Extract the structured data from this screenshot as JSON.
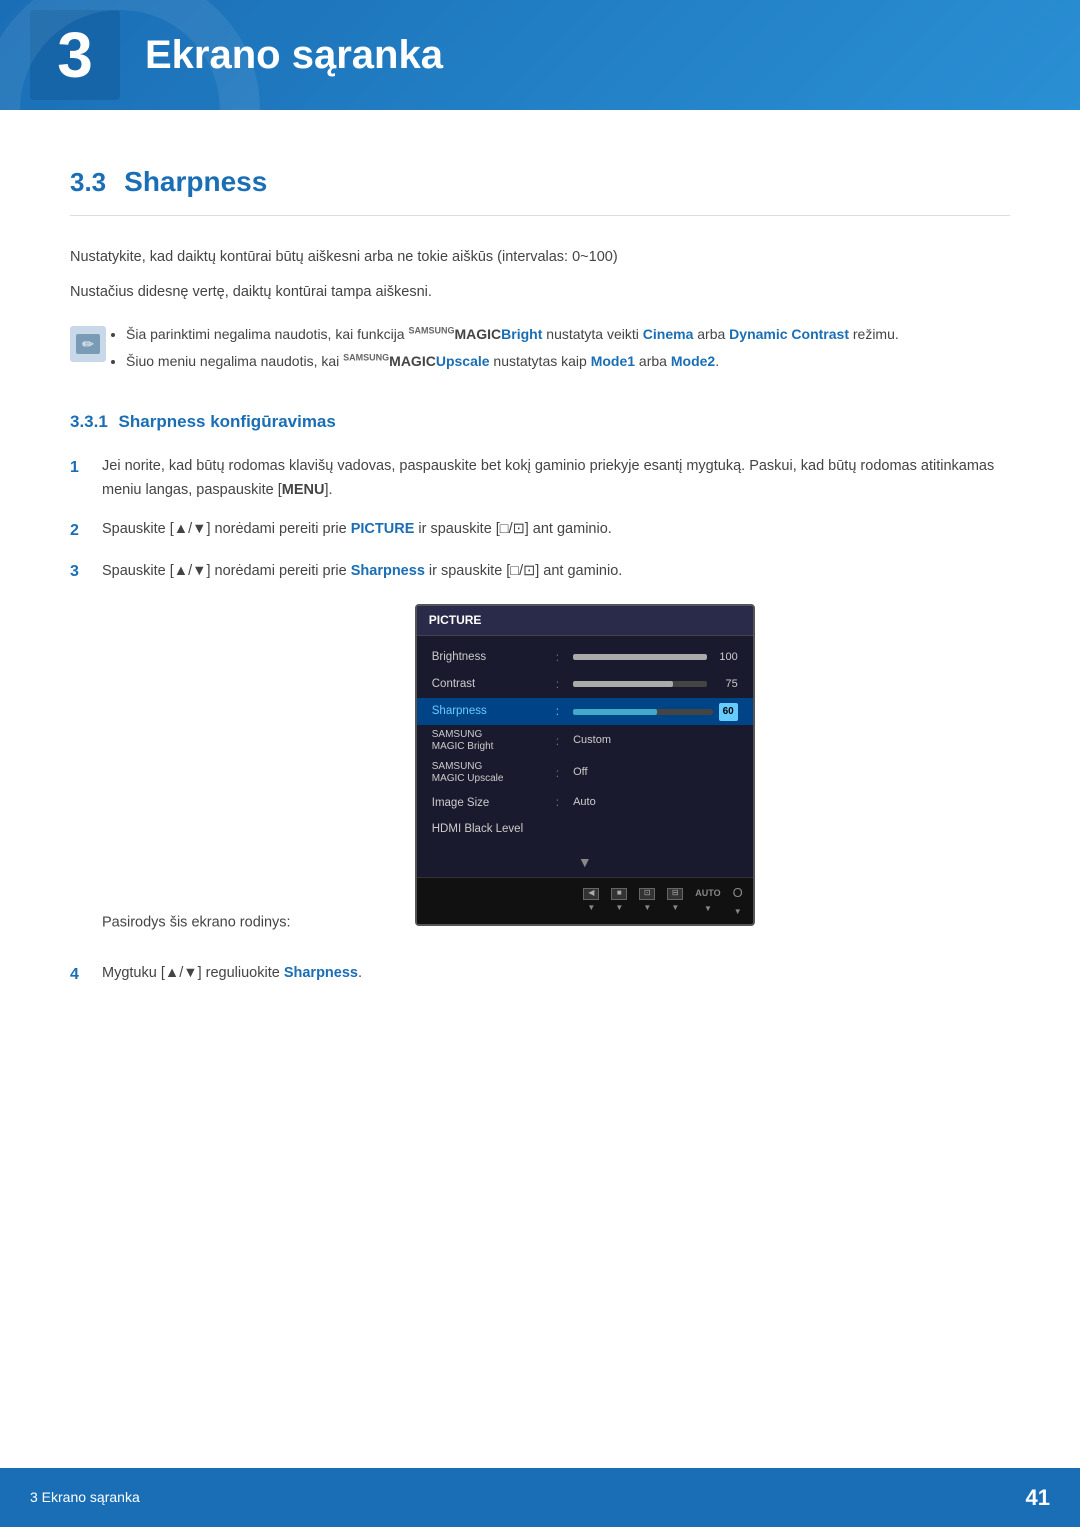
{
  "header": {
    "chapter_number": "3",
    "chapter_title": "Ekrano sąranka"
  },
  "section": {
    "number": "3.3",
    "title": "Sharpness",
    "description1": "Nustatykite, kad daiktų kontūrai būtų aiškesni arba ne tokie aiškūs (intervalas: 0~100)",
    "description2": "Nustačius didesnę vertę, daiktų kontūrai tampa aiškesni.",
    "notes": [
      "Šia parinktimi negalima naudotis, kai funkcija SAMSUNGBright nustatyta veikti Cinema arba Dynamic Contrast režimu.",
      "Šiuo meniu negalima naudotis, kai MAGICUpscale nustatytas kaip Mode1 arba Mode2."
    ]
  },
  "subsection": {
    "number": "3.3.1",
    "title": "Sharpness konfigūravimas"
  },
  "steps": [
    {
      "number": "1",
      "text": "Jei norite, kad būtų rodomas klavišų vadovas, paspauskite bet kokį gaminio priekyje esantį mygtuką. Paskui, kad būtų rodomas atitinkamas meniu langas, paspauskite [MENU]."
    },
    {
      "number": "2",
      "text": "Spauskite [▲/▼] norėdami pereiti prie PICTURE ir spauskite [□/⊡] ant gaminio."
    },
    {
      "number": "3",
      "text": "Spauskite [▲/▼] norėdami pereiti prie Sharpness ir spauskite [□/⊡] ant gaminio.",
      "sub_text": "Pasirodys šis ekrano rodinys:"
    },
    {
      "number": "4",
      "text": "Mygtuku [▲/▼] reguliuokite Sharpness."
    }
  ],
  "osd": {
    "title": "PICTURE",
    "items": [
      {
        "label": "Brightness",
        "type": "bar",
        "fill_percent": 100,
        "value": "100"
      },
      {
        "label": "Contrast",
        "type": "bar",
        "fill_percent": 75,
        "value": "75"
      },
      {
        "label": "Sharpness",
        "type": "bar",
        "fill_percent": 60,
        "value": "60",
        "highlighted": true
      },
      {
        "label": "SAMSUNG MAGIC Bright",
        "type": "text",
        "value": "Custom"
      },
      {
        "label": "SAMSUNG MAGIC Upscale",
        "type": "text",
        "value": "Off"
      },
      {
        "label": "Image Size",
        "type": "text",
        "value": "Auto"
      },
      {
        "label": "HDMI Black Level",
        "type": "text",
        "value": ""
      }
    ],
    "toolbar_icons": [
      "◀",
      "■",
      "⊡",
      "⊟",
      "AUTO",
      "Ο"
    ]
  },
  "footer": {
    "left": "3 Ekrano sąranka",
    "right": "41"
  }
}
